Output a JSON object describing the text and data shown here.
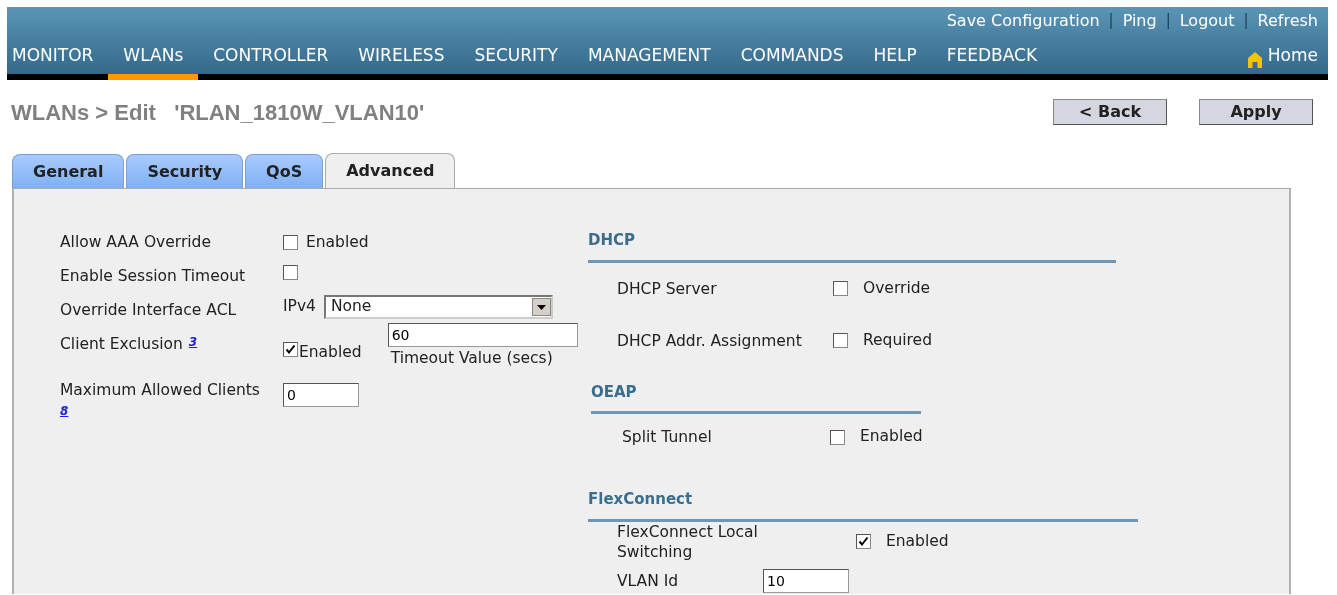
{
  "top_links": [
    {
      "kind": "link",
      "label": "Save Configuration"
    },
    {
      "kind": "separator",
      "label": "|"
    },
    {
      "kind": "link",
      "label": "Ping"
    },
    {
      "kind": "separator",
      "label": "|"
    },
    {
      "kind": "link",
      "label": "Logout"
    },
    {
      "kind": "separator",
      "label": "|"
    },
    {
      "kind": "link",
      "label": "Refresh"
    }
  ],
  "menu": [
    {
      "label": "MONITOR",
      "selected": false
    },
    {
      "label": "WLANs",
      "selected": true
    },
    {
      "label": "CONTROLLER",
      "selected": false
    },
    {
      "label": "WIRELESS",
      "selected": false
    },
    {
      "label": "SECURITY",
      "selected": false
    },
    {
      "label": "MANAGEMENT",
      "selected": false
    },
    {
      "label": "COMMANDS",
      "selected": false
    },
    {
      "label": "HELP",
      "selected": false
    },
    {
      "label": "FEEDBACK",
      "selected": false
    }
  ],
  "home_link": "Home",
  "page_title": "WLANs > Edit   'RLAN_1810W_VLAN10'",
  "buttons": [
    "< Back",
    "Apply"
  ],
  "tabs": [
    {
      "label": "General",
      "selected": false
    },
    {
      "label": "Security",
      "selected": false
    },
    {
      "label": "QoS",
      "selected": false
    },
    {
      "label": "Advanced",
      "selected": true
    }
  ],
  "left_fields": [
    {
      "kind": "checkbox",
      "label": "Allow AAA Override",
      "checked": false,
      "option": "Enabled"
    },
    {
      "kind": "checkbox",
      "label": "Enable Session Timeout",
      "checked": false
    },
    {
      "kind": "select",
      "label": "Override Interface ACL",
      "prefix": "IPv4",
      "value": "None"
    },
    {
      "kind": "checkbox_timeout",
      "label": "Client Exclusion",
      "footnote": "3",
      "checked": true,
      "option": "Enabled",
      "value": "60",
      "caption": "Timeout Value (secs)"
    },
    {
      "kind": "input",
      "label": "Maximum Allowed Clients",
      "footnote": "8",
      "value": "0"
    }
  ],
  "sections": [
    {
      "title": "DHCP",
      "rows": [
        {
          "kind": "checkbox",
          "label": "DHCP Server",
          "checked": false,
          "option": "Override"
        },
        {
          "kind": "checkbox",
          "label": "DHCP Addr. Assignment",
          "checked": false,
          "option": "Required"
        }
      ]
    },
    {
      "title": "OEAP",
      "rows": [
        {
          "kind": "checkbox",
          "label": "Split Tunnel",
          "checked": false,
          "option": "Enabled"
        }
      ]
    },
    {
      "title": "FlexConnect",
      "rows": [
        {
          "kind": "checkbox",
          "label": "FlexConnect Local Switching",
          "checked": true,
          "option": "Enabled"
        },
        {
          "kind": "input",
          "label": "VLAN Id",
          "value": "10"
        }
      ]
    }
  ]
}
